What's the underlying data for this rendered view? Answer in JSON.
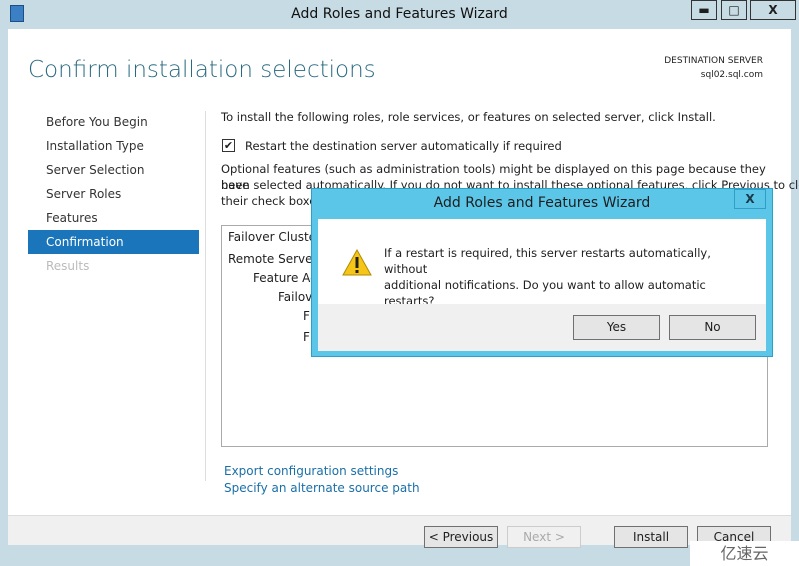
{
  "window": {
    "title": "Add Roles and Features Wizard",
    "controls": {
      "minimize": "▬",
      "maximize": "□",
      "close": "X"
    }
  },
  "page": {
    "title": "Confirm installation selections",
    "destination_label": "DESTINATION SERVER",
    "destination_value": "sql02.sql.com"
  },
  "sidebar": {
    "items": [
      {
        "label": "Before You Begin",
        "state": "normal"
      },
      {
        "label": "Installation Type",
        "state": "normal"
      },
      {
        "label": "Server Selection",
        "state": "normal"
      },
      {
        "label": "Server Roles",
        "state": "normal"
      },
      {
        "label": "Features",
        "state": "normal"
      },
      {
        "label": "Confirmation",
        "state": "selected"
      },
      {
        "label": "Results",
        "state": "disabled"
      }
    ]
  },
  "content": {
    "instruction": "To install the following roles, role services, or features on selected server, click Install.",
    "restart_checkbox": {
      "label": "Restart the destination server automatically if required",
      "checked": true
    },
    "optional_text_1": "Optional features (such as administration tools) might be displayed on this page because they have",
    "optional_text_2": "been selected automatically. If you do not want to install these optional features, click Previous to clear",
    "optional_text_3": "their check boxes.",
    "list_items": [
      "Failover Cluster",
      "Remote Server A",
      "Feature Ad",
      "Failov",
      "F",
      "F"
    ],
    "links": {
      "export": "Export configuration settings",
      "alternate_source": "Specify an alternate source path"
    }
  },
  "footer": {
    "previous": "< Previous",
    "next": "Next >",
    "install": "Install",
    "cancel": "Cancel"
  },
  "dialog": {
    "title": "Add Roles and Features Wizard",
    "close": "X",
    "message_1": "If a restart is required, this server restarts automatically, without",
    "message_2": "additional notifications. Do you want to allow automatic restarts?",
    "icon": "warning-icon",
    "yes": "Yes",
    "no": "No"
  },
  "watermark": "亿速云",
  "colors": {
    "accent": "#1a75bb",
    "dialog_frame": "#5bc6e8",
    "title": "#2a6a80",
    "link": "#1a6fa8"
  }
}
